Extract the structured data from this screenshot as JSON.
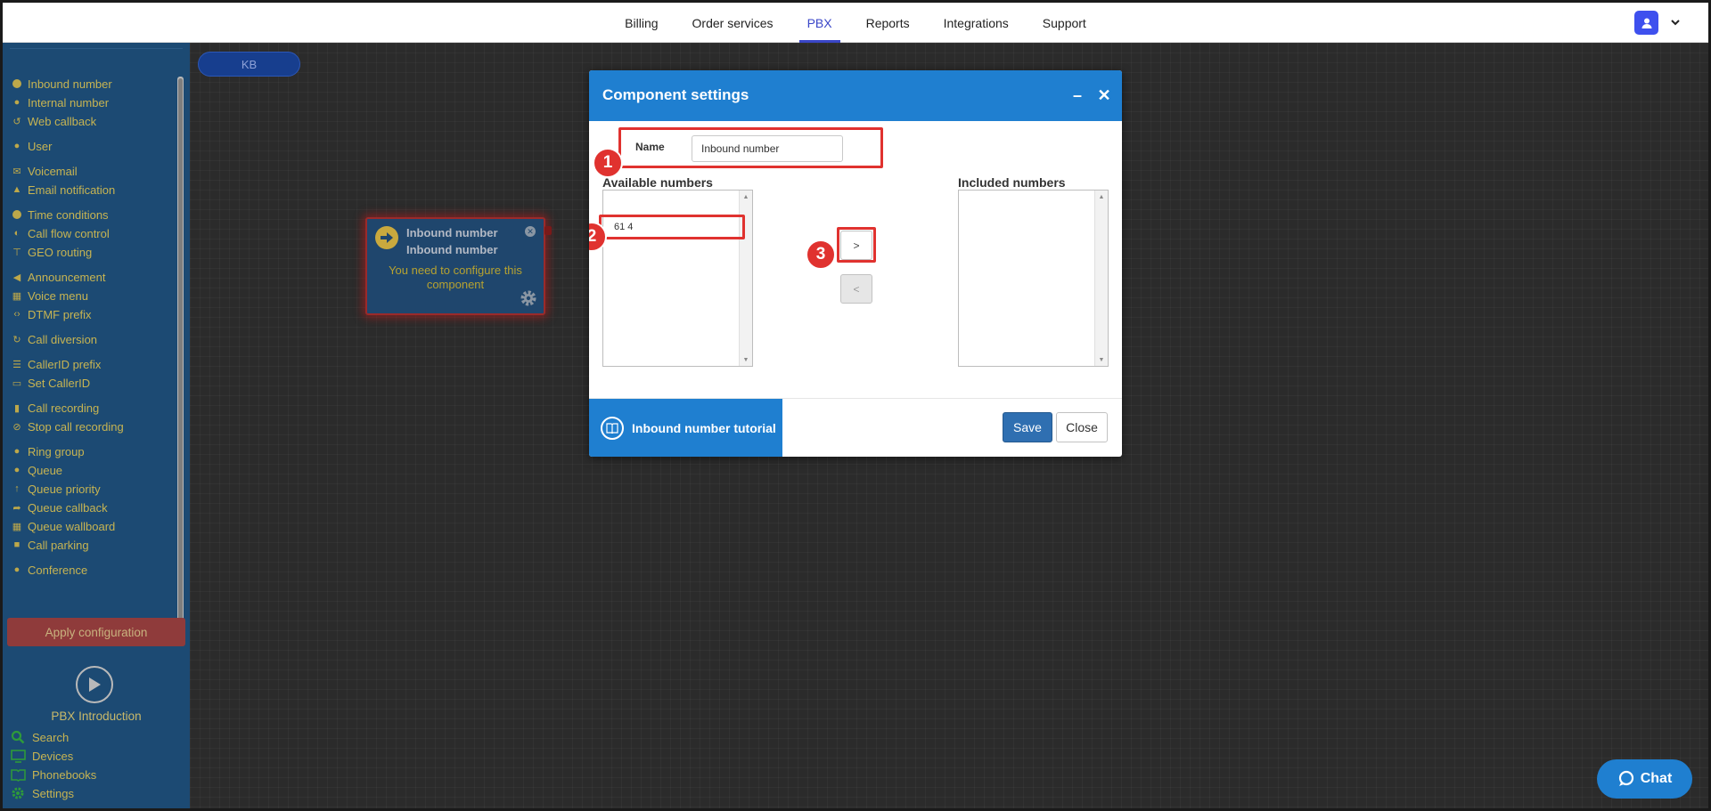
{
  "nav": {
    "items": [
      {
        "label": "Billing",
        "active": false
      },
      {
        "label": "Order services",
        "active": false
      },
      {
        "label": "PBX",
        "active": true
      },
      {
        "label": "Reports",
        "active": false
      },
      {
        "label": "Integrations",
        "active": false
      },
      {
        "label": "Support",
        "active": false
      }
    ],
    "accent_color": "#3a46c8"
  },
  "sidebar": {
    "items": [
      {
        "label": "Inbound number",
        "icon": "inbound-icon"
      },
      {
        "label": "Internal number",
        "icon": "pin-icon"
      },
      {
        "label": "Web callback",
        "icon": "undo-icon"
      },
      {
        "label": "User",
        "icon": "user-icon"
      },
      {
        "label": "Voicemail",
        "icon": "envelope-icon"
      },
      {
        "label": "Email notification",
        "icon": "bell-icon"
      },
      {
        "label": "Time conditions",
        "icon": "clock-icon"
      },
      {
        "label": "Call flow control",
        "icon": "toggle-icon"
      },
      {
        "label": "GEO routing",
        "icon": "sitemap-icon"
      },
      {
        "label": "Announcement",
        "icon": "megaphone-icon"
      },
      {
        "label": "Voice menu",
        "icon": "menu-grid-icon"
      },
      {
        "label": "DTMF prefix",
        "icon": "code-icon"
      },
      {
        "label": "Call diversion",
        "icon": "redo-icon"
      },
      {
        "label": "CallerID prefix",
        "icon": "list-icon"
      },
      {
        "label": "Set CallerID",
        "icon": "id-card-icon"
      },
      {
        "label": "Call recording",
        "icon": "microphone-icon"
      },
      {
        "label": "Stop call recording",
        "icon": "microphone-slash-icon"
      },
      {
        "label": "Ring group",
        "icon": "users-icon"
      },
      {
        "label": "Queue",
        "icon": "user-plus-icon"
      },
      {
        "label": "Queue priority",
        "icon": "arrow-up-icon"
      },
      {
        "label": "Queue callback",
        "icon": "share-icon"
      },
      {
        "label": "Queue wallboard",
        "icon": "table-icon"
      },
      {
        "label": "Call parking",
        "icon": "parking-icon"
      },
      {
        "label": "Conference",
        "icon": "comments-icon"
      }
    ],
    "apply_label": "Apply configuration",
    "intro_label": "PBX Introduction",
    "bottom_links": [
      {
        "label": "Search",
        "icon": "search-icon"
      },
      {
        "label": "Devices",
        "icon": "monitor-icon"
      },
      {
        "label": "Phonebooks",
        "icon": "book-icon"
      },
      {
        "label": "Settings",
        "icon": "gear-icon"
      }
    ]
  },
  "canvas": {
    "kb_label": "KB",
    "node": {
      "title_line1": "Inbound number",
      "title_line2": "Inbound number",
      "message": "You need to configure this component"
    }
  },
  "dialog": {
    "title": "Component settings",
    "name_label": "Name",
    "name_value": "Inbound number",
    "available_label": "Available numbers",
    "available_options": [
      "61 4"
    ],
    "included_label": "Included numbers",
    "included_options": [],
    "move_right_label": ">",
    "move_left_label": "<",
    "tutorial_label": "Inbound number tutorial",
    "save_label": "Save",
    "close_label": "Close",
    "annotations": [
      "1",
      "2",
      "3"
    ],
    "annotation_color": "#e0322f",
    "header_color": "#1f7fd0"
  },
  "chat": {
    "label": "Chat"
  }
}
